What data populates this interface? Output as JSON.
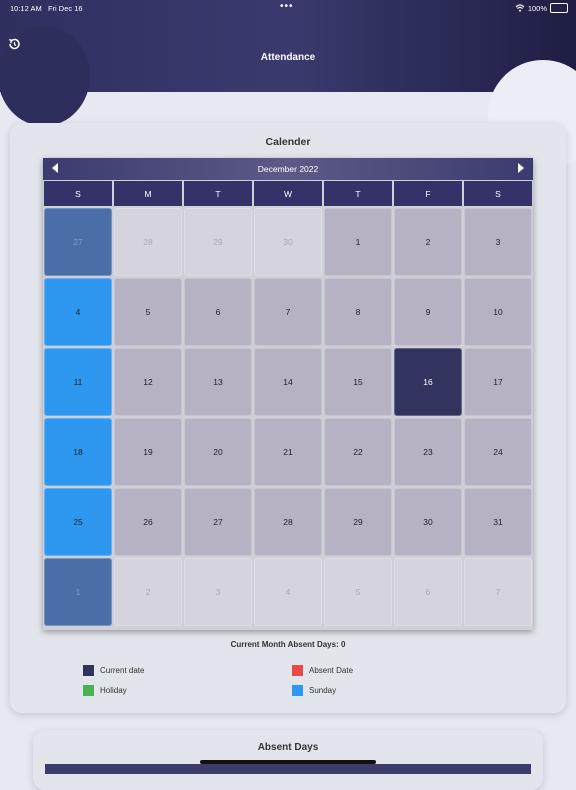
{
  "status": {
    "time": "10:12 AM",
    "date": "Fri Dec 16",
    "dots": "•••",
    "battery": "100%"
  },
  "header": {
    "title": "Attendance"
  },
  "calendar_card": {
    "title": "Calender",
    "month": "December  2022",
    "weekdays": [
      "S",
      "M",
      "T",
      "W",
      "T",
      "F",
      "S"
    ],
    "days": [
      {
        "n": "27",
        "t": "sun out"
      },
      {
        "n": "28",
        "t": "out"
      },
      {
        "n": "29",
        "t": "out"
      },
      {
        "n": "30",
        "t": "out"
      },
      {
        "n": "1",
        "t": ""
      },
      {
        "n": "2",
        "t": ""
      },
      {
        "n": "3",
        "t": ""
      },
      {
        "n": "4",
        "t": "sun"
      },
      {
        "n": "5",
        "t": ""
      },
      {
        "n": "6",
        "t": ""
      },
      {
        "n": "7",
        "t": ""
      },
      {
        "n": "8",
        "t": ""
      },
      {
        "n": "9",
        "t": ""
      },
      {
        "n": "10",
        "t": ""
      },
      {
        "n": "11",
        "t": "sun"
      },
      {
        "n": "12",
        "t": ""
      },
      {
        "n": "13",
        "t": ""
      },
      {
        "n": "14",
        "t": ""
      },
      {
        "n": "15",
        "t": ""
      },
      {
        "n": "16",
        "t": "today"
      },
      {
        "n": "17",
        "t": ""
      },
      {
        "n": "18",
        "t": "sun"
      },
      {
        "n": "19",
        "t": ""
      },
      {
        "n": "20",
        "t": ""
      },
      {
        "n": "21",
        "t": ""
      },
      {
        "n": "22",
        "t": ""
      },
      {
        "n": "23",
        "t": ""
      },
      {
        "n": "24",
        "t": ""
      },
      {
        "n": "25",
        "t": "sun"
      },
      {
        "n": "26",
        "t": ""
      },
      {
        "n": "27",
        "t": ""
      },
      {
        "n": "28",
        "t": ""
      },
      {
        "n": "29",
        "t": ""
      },
      {
        "n": "30",
        "t": ""
      },
      {
        "n": "31",
        "t": ""
      },
      {
        "n": "1",
        "t": "sun out"
      },
      {
        "n": "2",
        "t": "out"
      },
      {
        "n": "3",
        "t": "out"
      },
      {
        "n": "4",
        "t": "out"
      },
      {
        "n": "5",
        "t": "out"
      },
      {
        "n": "6",
        "t": "out"
      },
      {
        "n": "7",
        "t": "out"
      }
    ],
    "absent_summary": "Current Month Absent Days:  0",
    "legend": [
      {
        "label": "Current date",
        "color": "#33335f"
      },
      {
        "label": "Absent Date",
        "color": "#e84a4a"
      },
      {
        "label": "Holiday",
        "color": "#4caf50"
      },
      {
        "label": "Sunday",
        "color": "#2e97ef"
      }
    ]
  },
  "absent_card": {
    "title": "Absent Days"
  }
}
